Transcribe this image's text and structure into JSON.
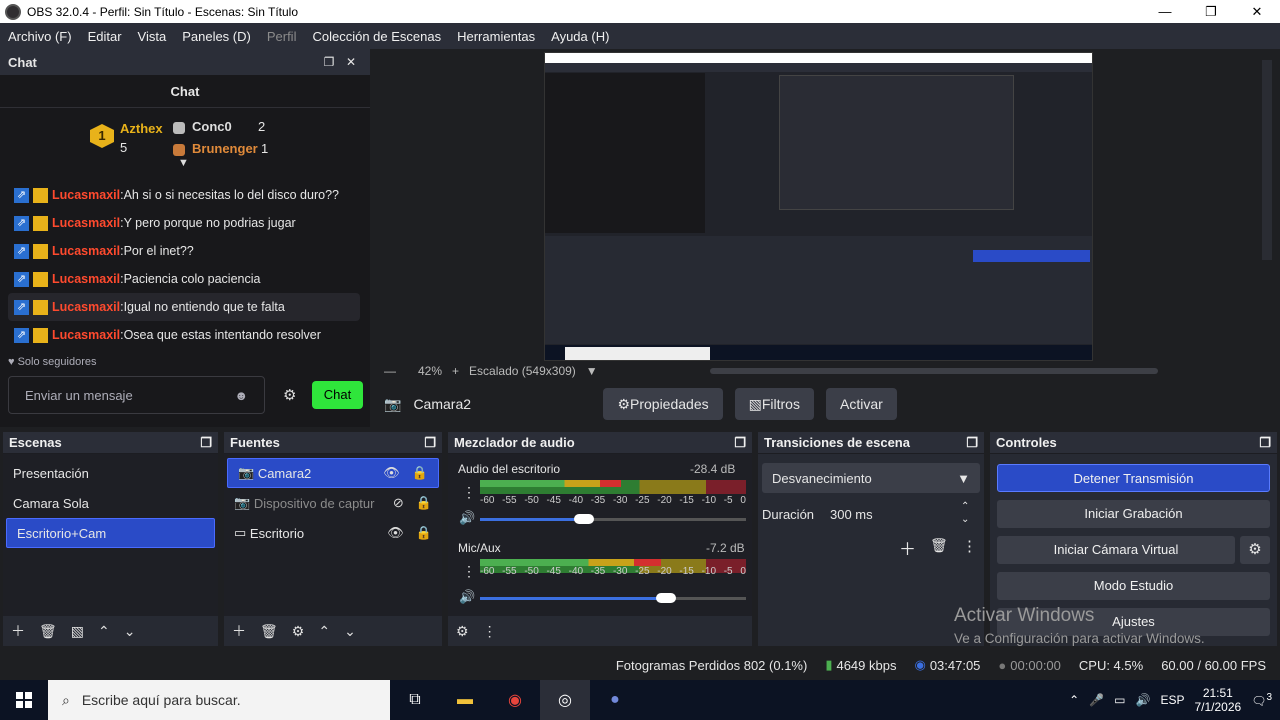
{
  "window": {
    "title": "OBS 32.0.4 - Perfil: Sin Título - Escenas: Sin Título",
    "minimize": "—",
    "maximize": "❐",
    "close": "✕"
  },
  "menu": [
    "Archivo (F)",
    "Editar",
    "Vista",
    "Paneles (D)",
    "Perfil",
    "Colección de Escenas",
    "Herramientas",
    "Ayuda (H)"
  ],
  "chat": {
    "dock_title": "Chat",
    "header": "Chat",
    "leaders": [
      {
        "name": "Azthex",
        "count": "5"
      },
      {
        "name": "Conc0",
        "count": "2"
      },
      {
        "name": "Brunenger",
        "count": "1"
      }
    ],
    "messages": [
      {
        "user": "Lucasmaxil",
        "text": "Ah si o si necesitas lo del disco duro??"
      },
      {
        "user": "Lucasmaxil",
        "text": "Y pero porque no podrias jugar"
      },
      {
        "user": "Lucasmaxil",
        "text": "Por el inet??"
      },
      {
        "user": "Lucasmaxil",
        "text": "Paciencia colo paciencia"
      },
      {
        "user": "Lucasmaxil",
        "text": "Igual no entiendo que te falta"
      },
      {
        "user": "Lucasmaxil",
        "text": "Osea que estas intentando resolver"
      }
    ],
    "followers_only": "Solo seguidores",
    "input_placeholder": "Enviar un mensaje",
    "send_label": "Chat"
  },
  "preview": {
    "zoom": "42%",
    "scale_label": "Escalado (549x309)"
  },
  "source_bar": {
    "source": "Camara2",
    "properties": "Propiedades",
    "filters": "Filtros",
    "activate": "Activar"
  },
  "scenes": {
    "title": "Escenas",
    "items": [
      "Presentación",
      "Camara Sola",
      "Escritorio+Cam"
    ]
  },
  "sources": {
    "title": "Fuentes",
    "items": [
      "Camara2",
      "Dispositivo de captur",
      "Escritorio"
    ]
  },
  "mixer": {
    "title": "Mezclador de audio",
    "channels": [
      {
        "name": "Audio del escritorio",
        "db": "-28.4 dB",
        "volume": 0.39
      },
      {
        "name": "Mic/Aux",
        "db": "-7.2 dB",
        "volume": 0.7
      }
    ],
    "ticks": [
      "-60",
      "-55",
      "-50",
      "-45",
      "-40",
      "-35",
      "-30",
      "-25",
      "-20",
      "-15",
      "-10",
      "-5",
      "0"
    ]
  },
  "transitions": {
    "title": "Transiciones de escena",
    "selected": "Desvanecimiento",
    "duration_label": "Duración",
    "duration": "300 ms"
  },
  "controls": {
    "title": "Controles",
    "buttons": [
      "Detener Transmisión",
      "Iniciar Grabación",
      "Iniciar Cámara Virtual",
      "Modo Estudio",
      "Ajustes"
    ]
  },
  "watermark": {
    "line1": "Activar Windows",
    "line2": "Ve a Configuración para activar Windows."
  },
  "status": {
    "dropped": "Fotogramas Perdidos 802 (0.1%)",
    "bitrate": "4649 kbps",
    "stream_time": "03:47:05",
    "rec_time": "00:00:00",
    "cpu": "CPU: 4.5%",
    "fps": "60.00 / 60.00 FPS"
  },
  "taskbar": {
    "search_placeholder": "Escribe aquí para buscar.",
    "lang": "ESP",
    "time": "21:51",
    "date": "7/1/2026",
    "notif_count": "3"
  }
}
